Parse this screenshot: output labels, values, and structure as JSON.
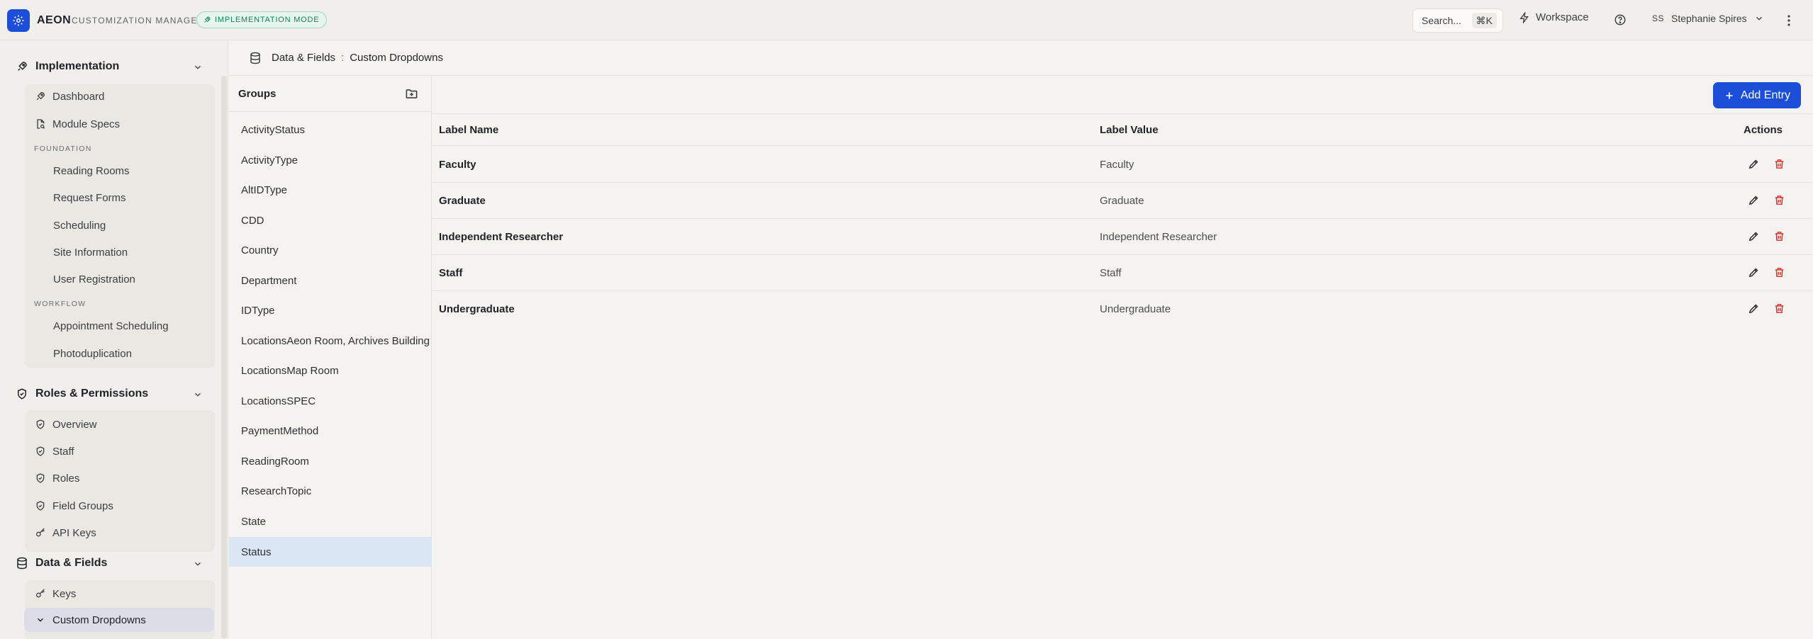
{
  "topbar": {
    "app_name": "AEON",
    "app_subtitle": "CUSTOMIZATION MANAGER",
    "mode_badge": "IMPLEMENTATION MODE",
    "search_label": "Search...",
    "search_shortcut": "⌘K",
    "workspace_label": "Workspace",
    "user_initials": "SS",
    "user_name": "Stephanie Spires"
  },
  "sidebar": {
    "implementation": {
      "title": "Implementation",
      "items": [
        "Dashboard",
        "Module Specs"
      ],
      "foundation_label": "FOUNDATION",
      "foundation_items": [
        "Reading Rooms",
        "Request Forms",
        "Scheduling",
        "Site Information",
        "User Registration"
      ],
      "workflow_label": "WORKFLOW",
      "workflow_items": [
        "Appointment Scheduling",
        "Photoduplication"
      ]
    },
    "roles": {
      "title": "Roles & Permissions",
      "items": [
        "Overview",
        "Staff",
        "Roles",
        "Field Groups",
        "API Keys"
      ]
    },
    "data_fields": {
      "title": "Data & Fields",
      "items": [
        "Keys",
        "Custom Dropdowns"
      ]
    }
  },
  "breadcrumb": {
    "section": "Data & Fields",
    "separator": ":",
    "page": "Custom Dropdowns"
  },
  "groups": {
    "title": "Groups",
    "items": [
      "ActivityStatus",
      "ActivityType",
      "AltIDType",
      "CDD",
      "Country",
      "Department",
      "IDType",
      "LocationsAeon Room, Archives Building",
      "LocationsMap Room",
      "LocationsSPEC",
      "PaymentMethod",
      "ReadingRoom",
      "ResearchTopic",
      "State",
      "Status"
    ],
    "selected": "Status"
  },
  "table": {
    "add_button": "Add Entry",
    "columns": [
      "Label Name",
      "Label Value",
      "Actions"
    ],
    "rows": [
      {
        "name": "Faculty",
        "value": "Faculty"
      },
      {
        "name": "Graduate",
        "value": "Graduate"
      },
      {
        "name": "Independent Researcher",
        "value": "Independent Researcher"
      },
      {
        "name": "Staff",
        "value": "Staff"
      },
      {
        "name": "Undergraduate",
        "value": "Undergraduate"
      }
    ]
  },
  "colors": {
    "accent": "#1d4ed8",
    "badge_green": "#15805a",
    "delete_red": "#dc2626",
    "selected_group_bg": "#dbe6f4"
  }
}
